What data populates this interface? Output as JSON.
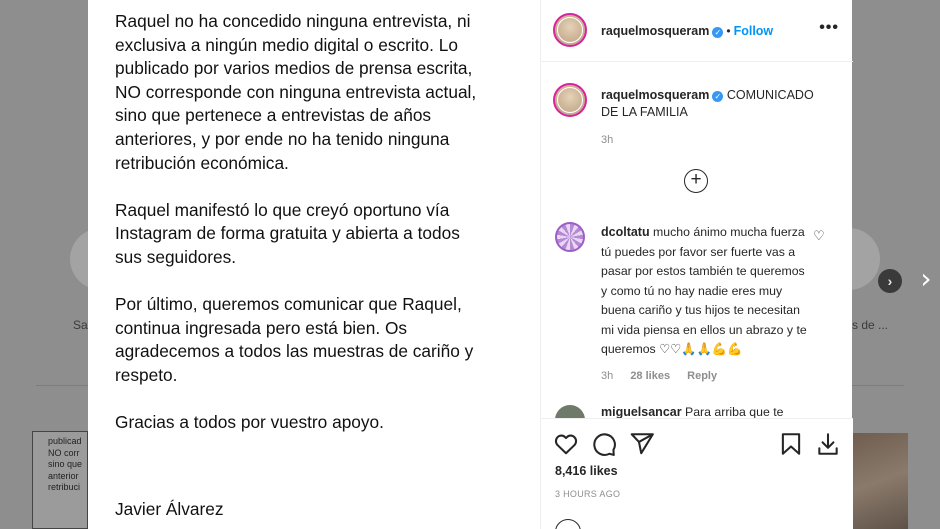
{
  "background": {
    "story_label_left": "Sa",
    "story_label_right": "s de ...",
    "thumb_left_lines": [
      "publicad",
      "NO corr",
      "sino que",
      "anterior",
      "retribuci"
    ]
  },
  "post_image": {
    "paragraphs": [
      "Raquel no ha concedido ninguna entrevista, ni\nexclusiva a ningún medio digital o escrito. Lo\npublicado por varios medios de prensa escrita,\nNO corresponde con ninguna entrevista actual,\nsino que pertenece a entrevistas de años\nanteriores, y por ende no ha tenido ninguna\nretribución económica.",
      "Raquel manifestó lo que creyó oportuno vía\nInstagram de forma gratuita y abierta a todos\nsus seguidores.",
      "Por último, queremos comunicar que Raquel,\ncontinua ingresada pero está bien. Os\nagradecemos a todos las muestras de cariño y\nrespeto.",
      "Gracias a todos por vuestro apoyo."
    ],
    "signature": "Javier Álvarez"
  },
  "header": {
    "username": "raquelmosqueram",
    "follow_label": "Follow",
    "more_icon": "more-options-icon"
  },
  "caption": {
    "username": "raquelmosqueram",
    "text": "COMUNICADO DE LA FAMILIA",
    "time": "3h"
  },
  "comments": [
    {
      "username": "dcoltatu",
      "text": "mucho ánimo mucha fuerza tú puedes por favor ser fuerte vas a pasar por estos también te queremos y como tú no hay nadie eres muy buena cariño y tus hijos te necesitan mi vida piensa en ellos un abrazo y te queremos ♡♡🙏🙏💪💪",
      "time": "3h",
      "likes": "28 likes",
      "reply_label": "Reply"
    },
    {
      "username": "miguelsancar",
      "text": "Para arriba que te"
    }
  ],
  "footer": {
    "likes": "8,416 likes",
    "post_time": "3 HOURS AGO"
  },
  "colors": {
    "accent": "#0095f6",
    "verified": "#3897f0",
    "text": "#262626",
    "muted": "#8e8e8e"
  }
}
